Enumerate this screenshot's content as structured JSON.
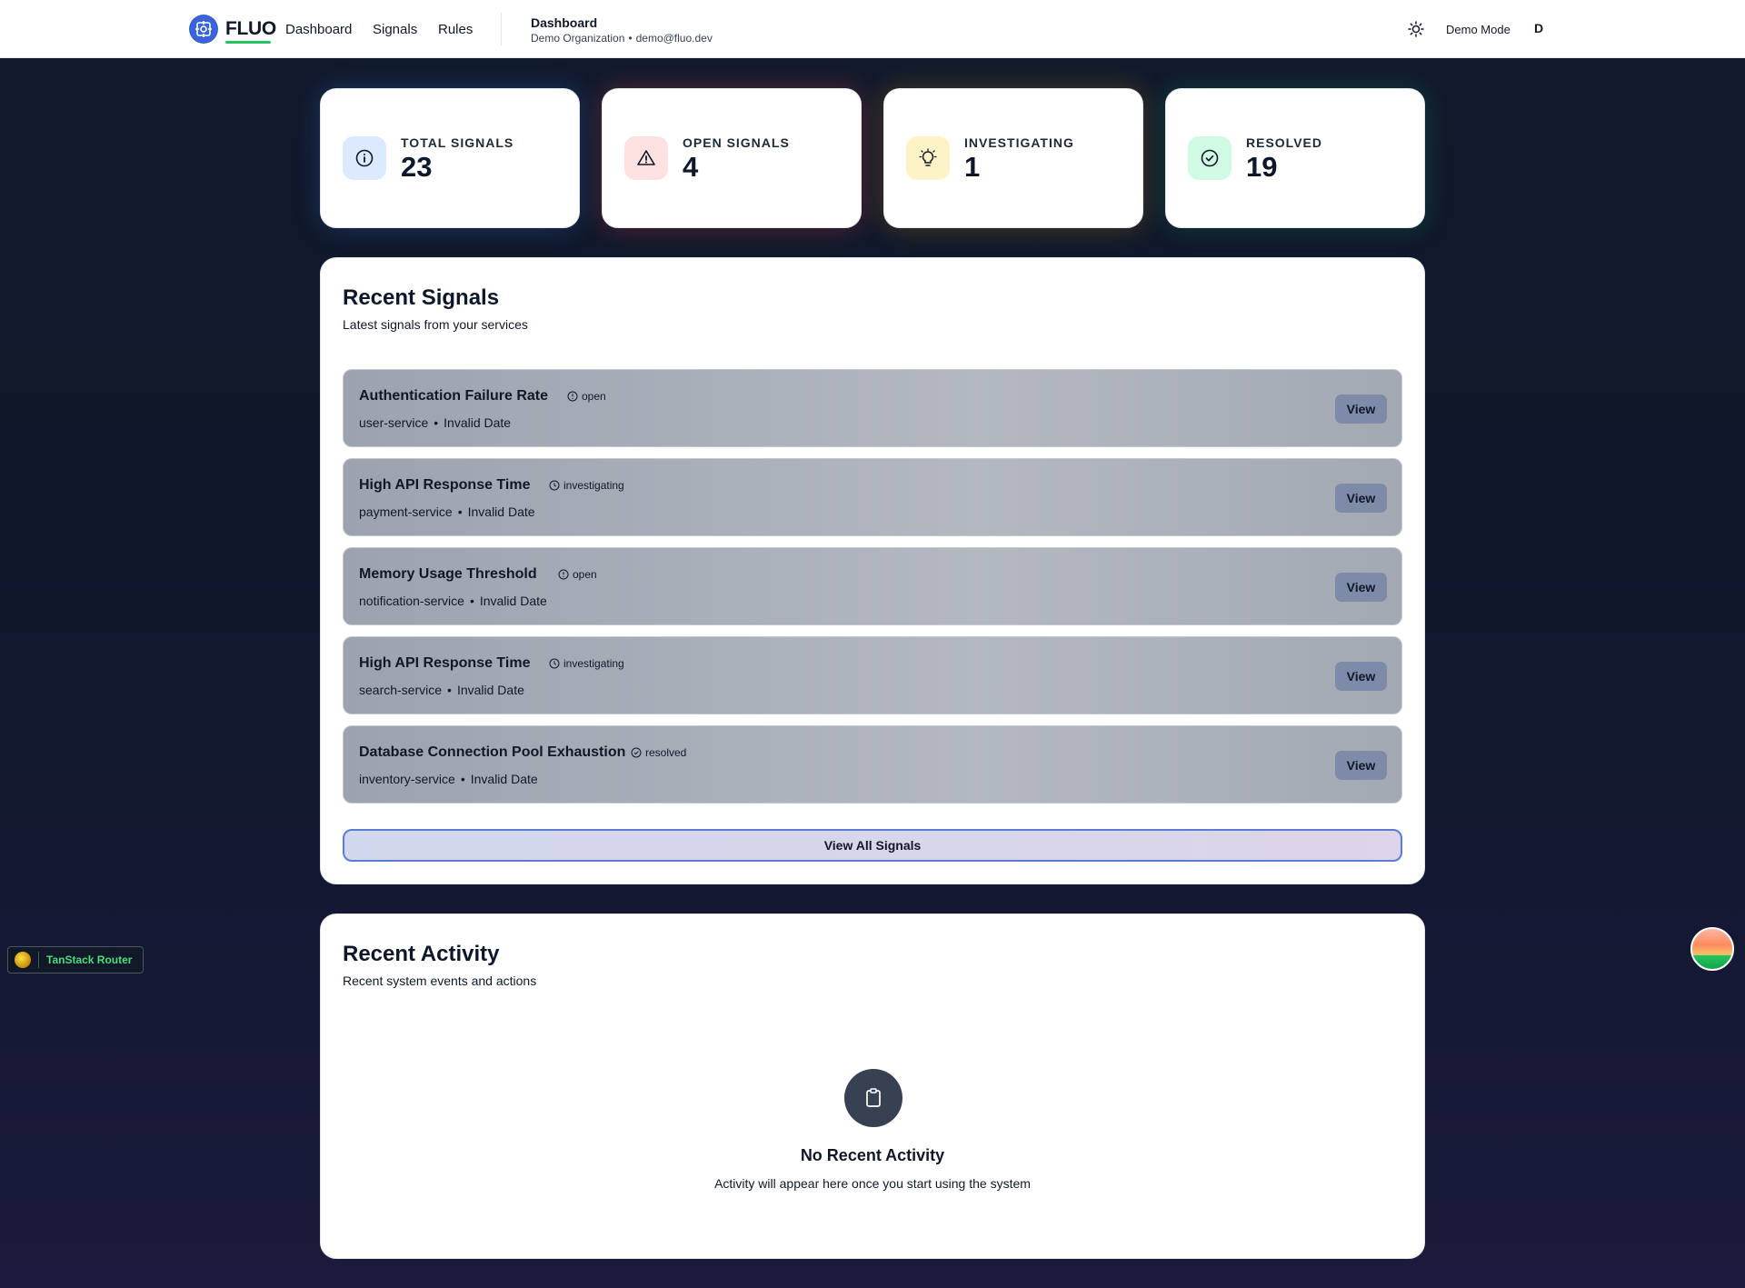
{
  "header": {
    "brand": "FLUO",
    "nav": [
      "Dashboard",
      "Signals",
      "Rules"
    ],
    "page_title": "Dashboard",
    "org": "Demo Organization",
    "separator": "•",
    "email": "demo@fluo.dev",
    "theme_icon": "sun-icon",
    "demo_mode": "Demo Mode",
    "avatar_initial": "D"
  },
  "stats": [
    {
      "label": "TOTAL SIGNALS",
      "value": "23",
      "icon": "info-icon",
      "color": "#3b82f6"
    },
    {
      "label": "OPEN SIGNALS",
      "value": "4",
      "icon": "warning-icon",
      "color": "#ef4444"
    },
    {
      "label": "INVESTIGATING",
      "value": "1",
      "icon": "lightbulb-icon",
      "color": "#f59e0b"
    },
    {
      "label": "RESOLVED",
      "value": "19",
      "icon": "check-circle-icon",
      "color": "#10b981"
    }
  ],
  "recent_signals": {
    "title": "Recent Signals",
    "subtitle": "Latest signals from your services",
    "view_label": "View",
    "view_all": "View All Signals",
    "items": [
      {
        "title": "Authentication Failure Rate",
        "status": "open",
        "service": "user-service",
        "date": "Invalid Date"
      },
      {
        "title": "High API Response Time",
        "status": "investigating",
        "service": "payment-service",
        "date": "Invalid Date"
      },
      {
        "title": "Memory Usage Threshold",
        "status": "open",
        "service": "notification-service",
        "date": "Invalid Date"
      },
      {
        "title": "High API Response Time",
        "status": "investigating",
        "service": "search-service",
        "date": "Invalid Date"
      },
      {
        "title": "Database Connection Pool Exhaustion",
        "status": "resolved",
        "service": "inventory-service",
        "date": "Invalid Date"
      }
    ]
  },
  "recent_activity": {
    "title": "Recent Activity",
    "subtitle": "Recent system events and actions",
    "empty_icon": "clipboard-icon",
    "empty_title": "No Recent Activity",
    "empty_desc": "Activity will appear here once you start using the system"
  },
  "devtools": {
    "label": "TanStack Router"
  }
}
